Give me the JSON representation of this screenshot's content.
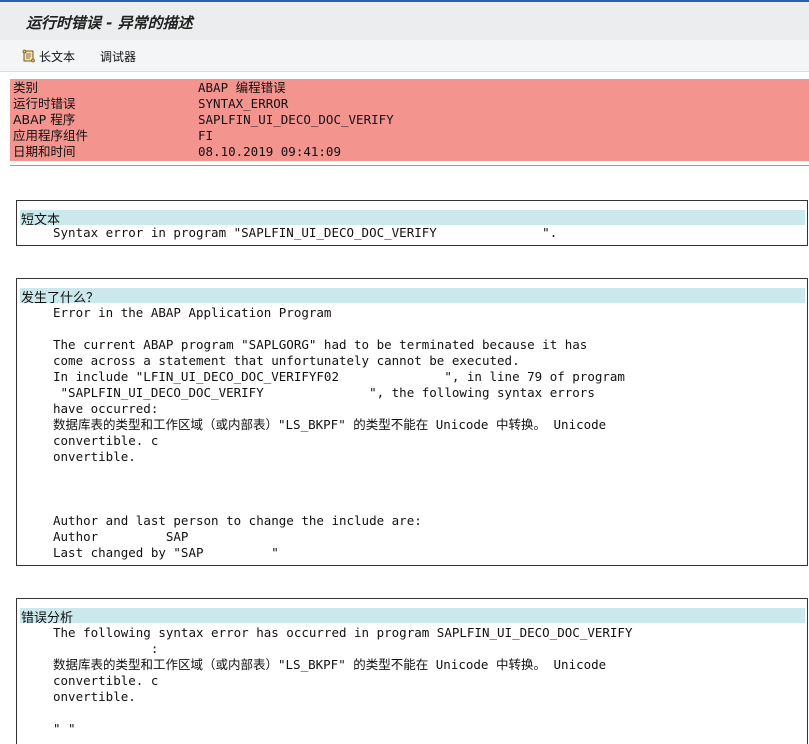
{
  "window": {
    "title": "运行时错误 - 异常的描述"
  },
  "toolbar": {
    "long_text_label": "长文本",
    "debugger_label": "调试器"
  },
  "info": {
    "rows": [
      {
        "label": "类别",
        "value": "ABAP 编程错误"
      },
      {
        "label": "运行时错误",
        "value": "SYNTAX_ERROR"
      },
      {
        "label": "ABAP 程序",
        "value": "SAPLFIN_UI_DECO_DOC_VERIFY"
      },
      {
        "label": "应用程序组件",
        "value": "FI"
      },
      {
        "label": "日期和时间",
        "value": "08.10.2019 09:41:09"
      }
    ]
  },
  "short_text": {
    "heading": "短文本",
    "lines": [
      "Syntax error in program \"SAPLFIN_UI_DECO_DOC_VERIFY              \"."
    ]
  },
  "what_happened": {
    "heading": "发生了什么？",
    "lines": [
      "Error in the ABAP Application Program",
      "",
      "The current ABAP program \"SAPLGORG\" had to be terminated because it has",
      "come across a statement that unfortunately cannot be executed.",
      "In include \"LFIN_UI_DECO_DOC_VERIFYF02              \", in line 79 of program",
      " \"SAPLFIN_UI_DECO_DOC_VERIFY              \", the following syntax errors",
      "have occurred:",
      "数据库表的类型和工作区域（或内部表）\"LS_BKPF\" 的类型不能在 Unicode 中转换。 Unicode",
      "convertible. c",
      "onvertible.",
      "",
      "",
      "",
      "Author and last person to change the include are:",
      "Author         SAP",
      "Last changed by \"SAP         \""
    ]
  },
  "error_analysis": {
    "heading": "错误分析",
    "lines": [
      "The following syntax error has occurred in program SAPLFIN_UI_DECO_DOC_VERIFY",
      "             :",
      "数据库表的类型和工作区域（或内部表）\"LS_BKPF\" 的类型不能在 Unicode 中转换。 Unicode",
      "convertible. c",
      "onvertible.",
      "",
      "\" \""
    ]
  }
}
